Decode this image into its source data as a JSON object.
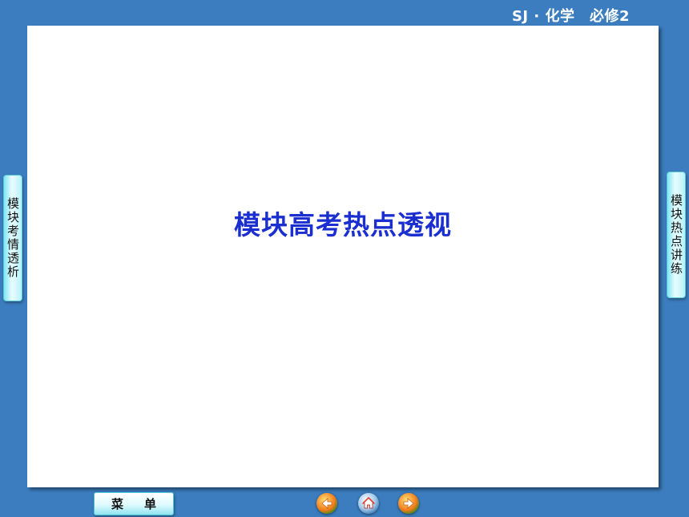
{
  "header": {
    "title": "SJ · 化学　必修2"
  },
  "slide": {
    "title": "模块高考热点透视"
  },
  "left_tab": {
    "label": "模块考情透析"
  },
  "right_tab": {
    "label": "模块热点讲练"
  },
  "bottom_menu": {
    "label": "菜单"
  },
  "nav": {
    "prev_icon": "arrow-left-icon",
    "home_icon": "home-icon",
    "next_icon": "arrow-right-icon"
  }
}
